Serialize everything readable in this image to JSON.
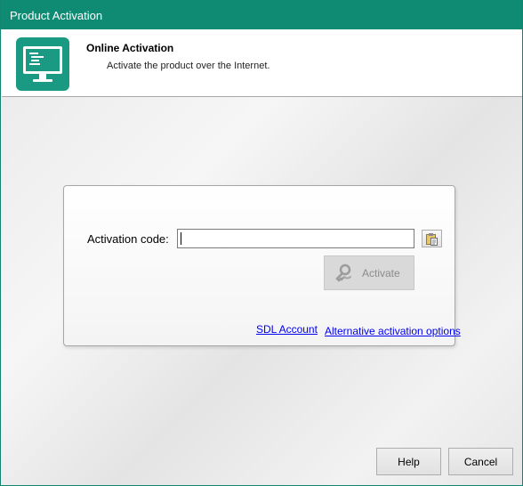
{
  "window": {
    "title": "Product Activation"
  },
  "header": {
    "title": "Online Activation",
    "subtitle": "Activate the product over the Internet.",
    "icon": "monitor-code-icon"
  },
  "form": {
    "code_label": "Activation code:",
    "code_value": "",
    "paste_icon": "clipboard-paste-icon",
    "activate_label": "Activate",
    "activate_icon": "key-hand-icon",
    "activate_enabled": false
  },
  "links": {
    "sdl_account": "SDL Account",
    "alternative": "Alternative activation options"
  },
  "footer": {
    "help_label": "Help",
    "cancel_label": "Cancel"
  },
  "colors": {
    "titlebar": "#0f8b73",
    "icon_bg": "#1a9a82",
    "link": "#0000ee"
  }
}
